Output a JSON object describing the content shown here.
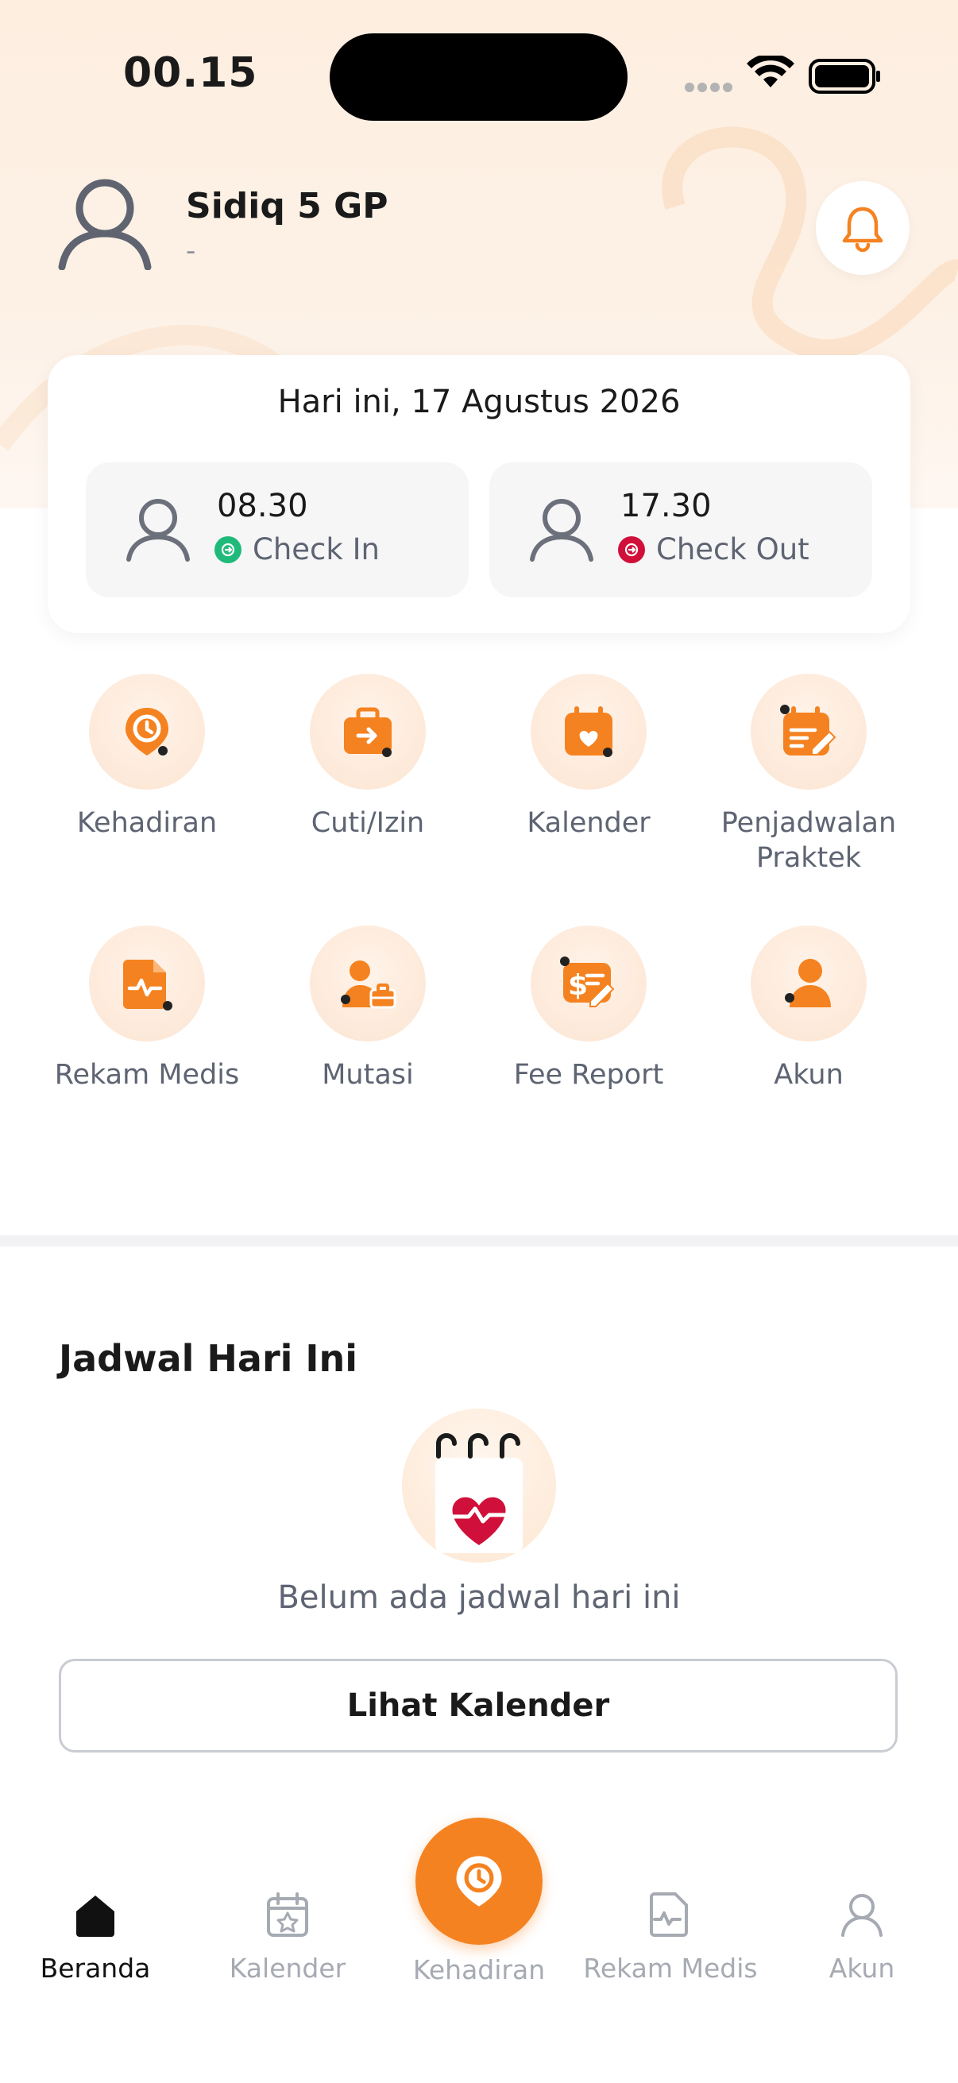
{
  "status_bar": {
    "time": "00.15"
  },
  "header": {
    "user_name": "Sidiq 5 GP",
    "user_subtitle": "-"
  },
  "attendance": {
    "date_label": "Hari ini, 17 Agustus 2026",
    "check_in": {
      "time": "08.30",
      "label": "Check In"
    },
    "check_out": {
      "time": "17.30",
      "label": "Check Out"
    }
  },
  "menu": {
    "items": [
      {
        "label": "Kehadiran",
        "icon": "clock-pin-icon"
      },
      {
        "label": "Cuti/Izin",
        "icon": "briefcase-arrow-icon"
      },
      {
        "label": "Kalender",
        "icon": "calendar-heart-icon"
      },
      {
        "label": "Penjadwalan Praktek",
        "icon": "calendar-edit-icon"
      },
      {
        "label": "Rekam Medis",
        "icon": "medical-record-icon"
      },
      {
        "label": "Mutasi",
        "icon": "user-transfer-icon"
      },
      {
        "label": "Fee Report",
        "icon": "fee-report-icon"
      },
      {
        "label": "Akun",
        "icon": "user-icon"
      }
    ]
  },
  "schedule": {
    "title": "Jadwal Hari Ini",
    "empty_text": "Belum ada jadwal hari ini",
    "button_label": "Lihat Kalender"
  },
  "bottom_nav": {
    "items": [
      {
        "label": "Beranda",
        "active": true
      },
      {
        "label": "Kalender",
        "active": false
      },
      {
        "label": "Kehadiran",
        "active": false
      },
      {
        "label": "Rekam Medis",
        "active": false
      },
      {
        "label": "Akun",
        "active": false
      }
    ]
  },
  "colors": {
    "accent": "#f58220",
    "check_in": "#1fba7a",
    "check_out": "#d0103a",
    "muted": "#5e6472"
  }
}
